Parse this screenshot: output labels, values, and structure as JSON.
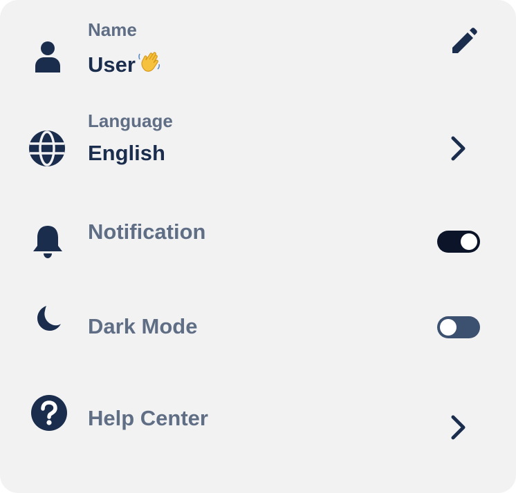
{
  "settings": {
    "name": {
      "label": "Name",
      "value": "User",
      "value_emoji": "waving-hand"
    },
    "language": {
      "label": "Language",
      "value": "English"
    },
    "notification": {
      "label": "Notification",
      "enabled": true
    },
    "dark_mode": {
      "label": "Dark Mode",
      "enabled": false
    },
    "help_center": {
      "label": "Help Center"
    }
  },
  "colors": {
    "card_background": "#f2f2f3",
    "icon": "#1b2d4d",
    "label": "#5f6e85",
    "value": "#1b2d4d",
    "toggle_on": "#0b1428",
    "toggle_off": "#3c5170"
  }
}
